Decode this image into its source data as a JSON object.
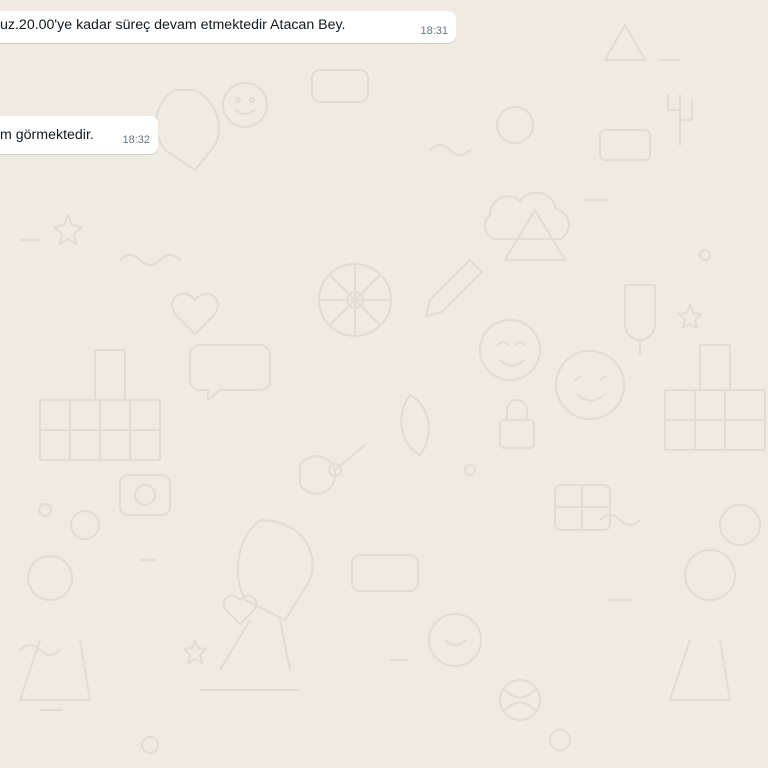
{
  "chat": {
    "background_color": "#efeae2",
    "wallpaper_icon": "doodle-pattern-icon",
    "messages": [
      {
        "text": "uz.20.00'ye kadar süreç devam etmektedir Atacan Bey.",
        "time": "18:31"
      },
      {
        "text": "m görmektedir.",
        "time": "18:32"
      }
    ]
  }
}
